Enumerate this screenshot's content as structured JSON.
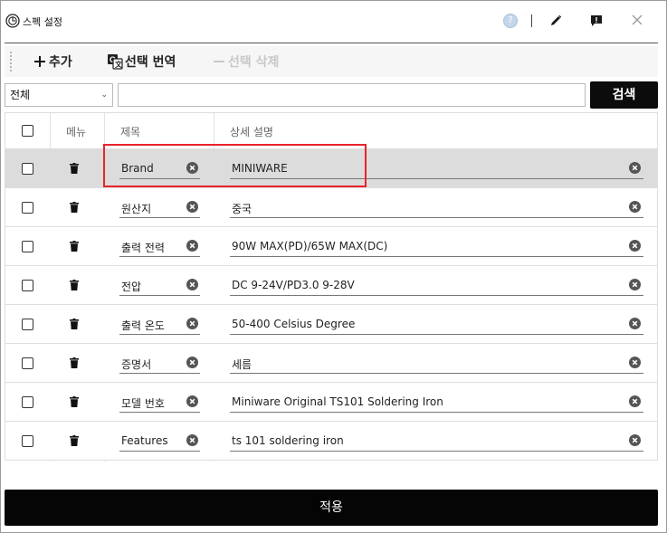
{
  "window": {
    "title": "스펙 설정",
    "help_label": "?"
  },
  "toolbar": {
    "add_label": "추가",
    "translate_label": "선택 번역",
    "delete_label": "선택 삭제"
  },
  "filter": {
    "selected": "전체",
    "search_value": "",
    "search_label": "검색"
  },
  "table": {
    "headers": {
      "menu": "메뉴",
      "title": "제목",
      "description": "상세 설명"
    },
    "rows": [
      {
        "title": "Brand",
        "description": "MINIWARE",
        "selected": true
      },
      {
        "title": "원산지",
        "description": "중국"
      },
      {
        "title": "출력 전력",
        "description": "90W MAX(PD)/65W MAX(DC)"
      },
      {
        "title": "전압",
        "description": "DC 9-24V/PD3.0 9-28V"
      },
      {
        "title": "출력 온도",
        "description": "50-400 Celsius Degree"
      },
      {
        "title": "증명서",
        "description": "세름"
      },
      {
        "title": "모델 번호",
        "description": "Miniware Original TS101 Soldering Iron"
      },
      {
        "title": "Features",
        "description": "ts 101 soldering iron"
      }
    ]
  },
  "apply_label": "적용",
  "colors": {
    "accent_dark": "#0c0c0c",
    "highlight": "#e8242a",
    "selected_row": "#dcdcdc"
  },
  "icons": [
    "app-logo-icon",
    "help-icon",
    "edit-pencil-icon",
    "report-icon",
    "close-icon",
    "plus-icon",
    "translate-icon",
    "minus-icon",
    "chevron-down-icon",
    "trash-icon",
    "clear-icon"
  ]
}
